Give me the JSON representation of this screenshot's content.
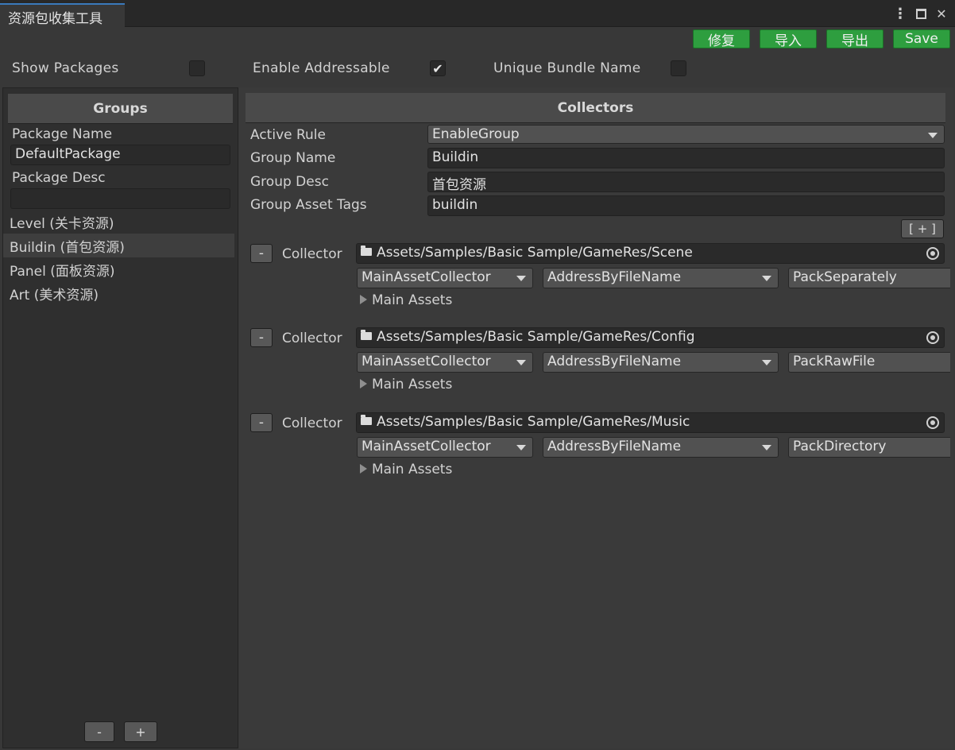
{
  "window": {
    "tab_title": "资源包收集工具",
    "icons": [
      "more-vert-icon",
      "maximize-icon",
      "close-icon"
    ],
    "more_glyph": "⋮",
    "close_glyph": "✕"
  },
  "toolbar": {
    "fix": "修复",
    "import": "导入",
    "export": "导出",
    "save": "Save",
    "accent": "#2e9e3f"
  },
  "options": {
    "show_packages": {
      "label": "Show Packages",
      "checked": false
    },
    "enable_addressable": {
      "label": "Enable Addressable",
      "checked": true,
      "mark": "✔"
    },
    "unique_bundle_name": {
      "label": "Unique Bundle Name",
      "checked": false
    }
  },
  "groups_panel": {
    "header": "Groups",
    "package_name_label": "Package Name",
    "package_name_value": "DefaultPackage",
    "package_desc_label": "Package Desc",
    "package_desc_value": "",
    "items": [
      {
        "label": "Level (关卡资源)",
        "selected": false
      },
      {
        "label": "Buildin (首包资源)",
        "selected": true
      },
      {
        "label": "Panel (面板资源)",
        "selected": false
      },
      {
        "label": "Art (美术资源)",
        "selected": false
      }
    ],
    "remove_label": "-",
    "add_label": "+"
  },
  "collectors_panel": {
    "header": "Collectors",
    "active_rule_label": "Active Rule",
    "active_rule_value": "EnableGroup",
    "group_name_label": "Group Name",
    "group_name_value": "Buildin",
    "group_desc_label": "Group Desc",
    "group_desc_value": "首包资源",
    "group_tags_label": "Group Asset Tags",
    "group_tags_value": "buildin",
    "add_collector_label": "[ + ]",
    "collectors": [
      {
        "remove": "-",
        "label": "Collector",
        "path": "Assets/Samples/Basic Sample/GameRes/Scene",
        "type": "MainAssetCollector",
        "address": "AddressByFileName",
        "pack": "PackSeparately",
        "foldout": "Main Assets"
      },
      {
        "remove": "-",
        "label": "Collector",
        "path": "Assets/Samples/Basic Sample/GameRes/Config",
        "type": "MainAssetCollector",
        "address": "AddressByFileName",
        "pack": "PackRawFile",
        "foldout": "Main Assets"
      },
      {
        "remove": "-",
        "label": "Collector",
        "path": "Assets/Samples/Basic Sample/GameRes/Music",
        "type": "MainAssetCollector",
        "address": "AddressByFileName",
        "pack": "PackDirectory",
        "foldout": "Main Assets"
      }
    ]
  }
}
